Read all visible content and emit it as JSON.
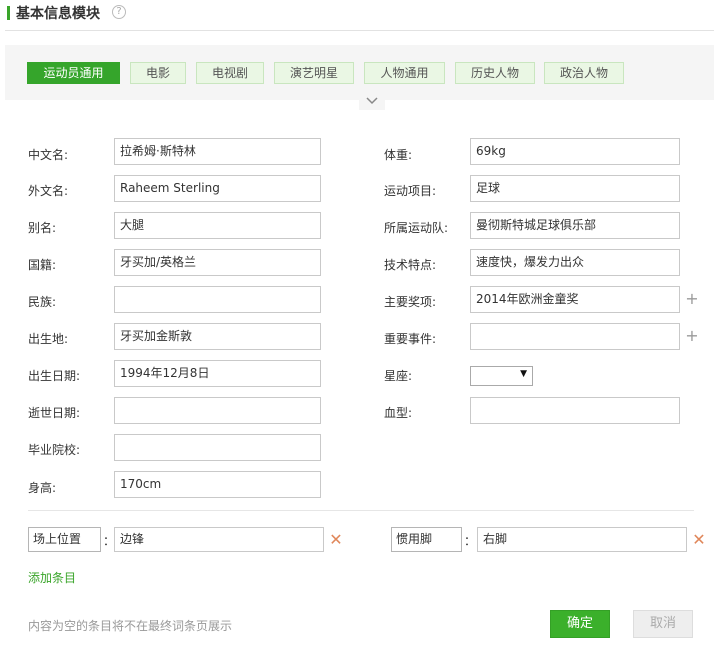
{
  "header": {
    "title": "基本信息模块",
    "help_icon": "?"
  },
  "tabs": [
    {
      "label": "运动员通用",
      "active": true
    },
    {
      "label": "电影",
      "active": false
    },
    {
      "label": "电视剧",
      "active": false
    },
    {
      "label": "演艺明星",
      "active": false
    },
    {
      "label": "人物通用",
      "active": false
    },
    {
      "label": "历史人物",
      "active": false
    },
    {
      "label": "政治人物",
      "active": false
    }
  ],
  "collapse_icon": "chevron-down-icon",
  "left_fields": [
    {
      "label": "中文名:",
      "value": "拉希姆·斯特林"
    },
    {
      "label": "外文名:",
      "value": "Raheem Sterling"
    },
    {
      "label": "别名:",
      "value": "大腿"
    },
    {
      "label": "国籍:",
      "value": "牙买加/英格兰"
    },
    {
      "label": "民族:",
      "value": ""
    },
    {
      "label": "出生地:",
      "value": "牙买加金斯敦"
    },
    {
      "label": "出生日期:",
      "value": "1994年12月8日"
    },
    {
      "label": "逝世日期:",
      "value": ""
    },
    {
      "label": "毕业院校:",
      "value": ""
    },
    {
      "label": "身高:",
      "value": "170cm"
    }
  ],
  "right_fields": [
    {
      "label": "体重:",
      "value": "69kg"
    },
    {
      "label": "运动项目:",
      "value": "足球"
    },
    {
      "label": "所属运动队:",
      "value": "曼彻斯特城足球俱乐部"
    },
    {
      "label": "技术特点:",
      "value": "速度快，爆发力出众"
    },
    {
      "label": "主要奖项:",
      "value": "2014年欧洲金童奖"
    },
    {
      "label": "重要事件:",
      "value": ""
    },
    {
      "label": "星座:",
      "value": ""
    },
    {
      "label": "血型:",
      "value": ""
    }
  ],
  "custom_attrs": [
    {
      "key": "场上位置",
      "colon": "：",
      "value": "边锋"
    },
    {
      "key": "惯用脚",
      "colon": "：",
      "value": "右脚"
    }
  ],
  "add_item_label": "添加条目",
  "footer_note": "内容为空的条目将不在最终词条页展示",
  "confirm_label": "确定",
  "cancel_label": "取消",
  "colors": {
    "accent": "#3aa52a",
    "delete": "#e0875a"
  }
}
